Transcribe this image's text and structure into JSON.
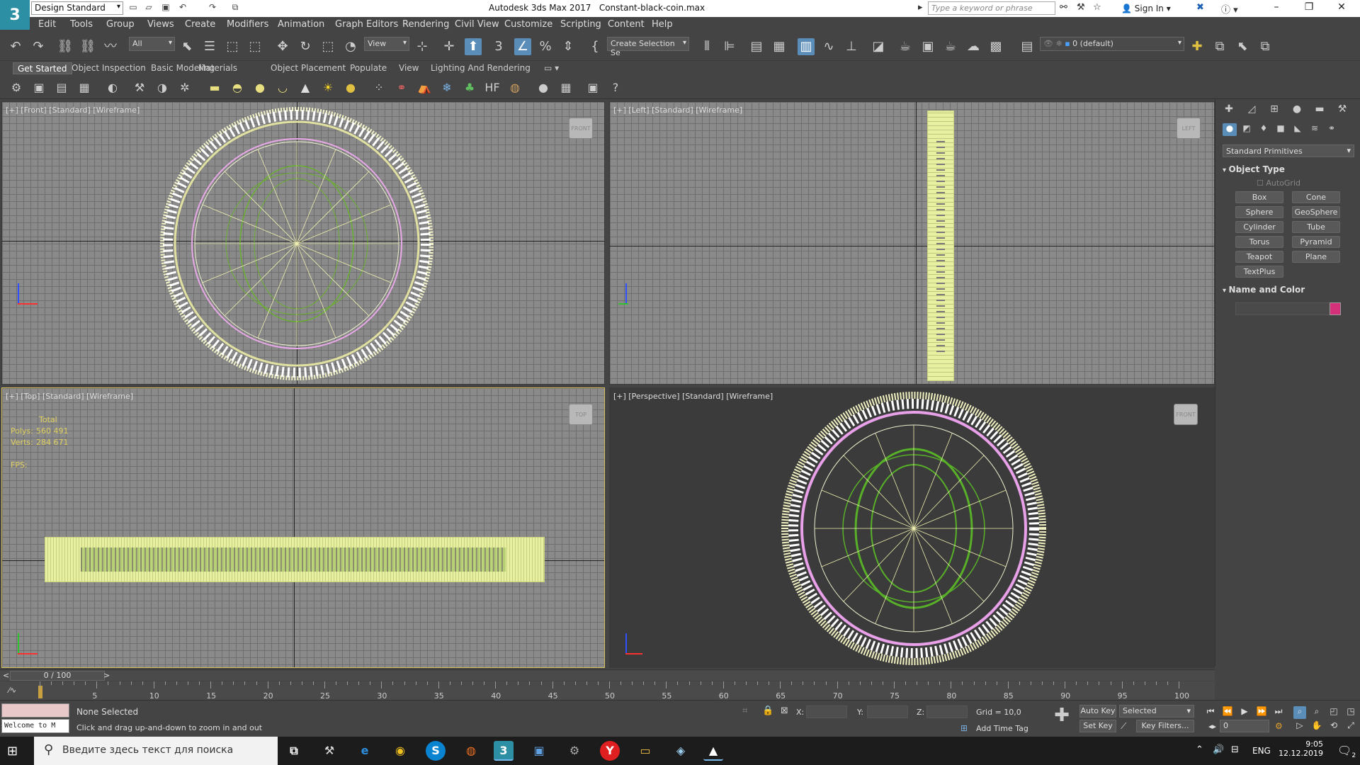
{
  "titlebar": {
    "logo": "3",
    "workspace": "Design Standard",
    "app_title": "Autodesk 3ds Max 2017",
    "file_name": "Constant-black-coin.max",
    "search_placeholder": "Type a keyword or phrase",
    "sign_in": "Sign In"
  },
  "menu": [
    "Edit",
    "Tools",
    "Group",
    "Views",
    "Create",
    "Modifiers",
    "Animation",
    "Graph Editors",
    "Rendering",
    "Civil View",
    "Customize",
    "Scripting",
    "Content",
    "Help"
  ],
  "maintoolbar": {
    "selection_filter": "All",
    "ref_coord": "View",
    "selection_set": "Create Selection Se",
    "layer": "0 (default)"
  },
  "ribbon_tabs": [
    "Get Started",
    "Object Inspection",
    "Basic Modeling",
    "Materials",
    "Object Placement",
    "Populate",
    "View",
    "Lighting And Rendering"
  ],
  "viewports": {
    "front": {
      "label": "[+] [Front] [Standard] [Wireframe]",
      "cube": "FRONT"
    },
    "left": {
      "label": "[+] [Left] [Standard] [Wireframe]",
      "cube": "LEFT"
    },
    "top": {
      "label": "[+] [Top] [Standard] [Wireframe]",
      "cube": "TOP"
    },
    "persp": {
      "label": "[+] [Perspective] [Standard] [Wireframe]",
      "cube": "FRONT"
    }
  },
  "stats": {
    "total": "Total",
    "polys_label": "Polys:",
    "polys_value": "560 491",
    "verts_label": "Verts:",
    "verts_value": "284 671",
    "fps_label": "FPS:"
  },
  "command_panel": {
    "category": "Standard Primitives",
    "object_type": "Object Type",
    "autogrid": "AutoGrid",
    "buttons": [
      "Box",
      "Cone",
      "Sphere",
      "GeoSphere",
      "Cylinder",
      "Tube",
      "Torus",
      "Pyramid",
      "Teapot",
      "Plane",
      "TextPlus"
    ],
    "name_and_color": "Name and Color",
    "color": "#d4317a"
  },
  "timeline": {
    "frame_display": "0 / 100",
    "ticks": [
      "5",
      "10",
      "15",
      "20",
      "25",
      "30",
      "35",
      "40",
      "45",
      "50",
      "55",
      "60",
      "65",
      "70",
      "75",
      "80",
      "85",
      "90",
      "95",
      "100"
    ]
  },
  "status": {
    "maxscript": "",
    "welcome": "Welcome to M",
    "selection": "None Selected",
    "prompt": "Click and drag up-and-down to zoom in and out",
    "x_label": "X:",
    "y_label": "Y:",
    "z_label": "Z:",
    "grid": "Grid = 10,0",
    "add_time_tag": "Add Time Tag",
    "auto_key": "Auto Key",
    "set_key": "Set Key",
    "key_mode": "Selected",
    "key_filters": "Key Filters...",
    "current_frame": "0"
  },
  "taskbar": {
    "search_placeholder": "Введите здесь текст для поиска",
    "lang": "ENG",
    "time": "9:05",
    "date": "12.12.2019",
    "notifications": "2"
  }
}
